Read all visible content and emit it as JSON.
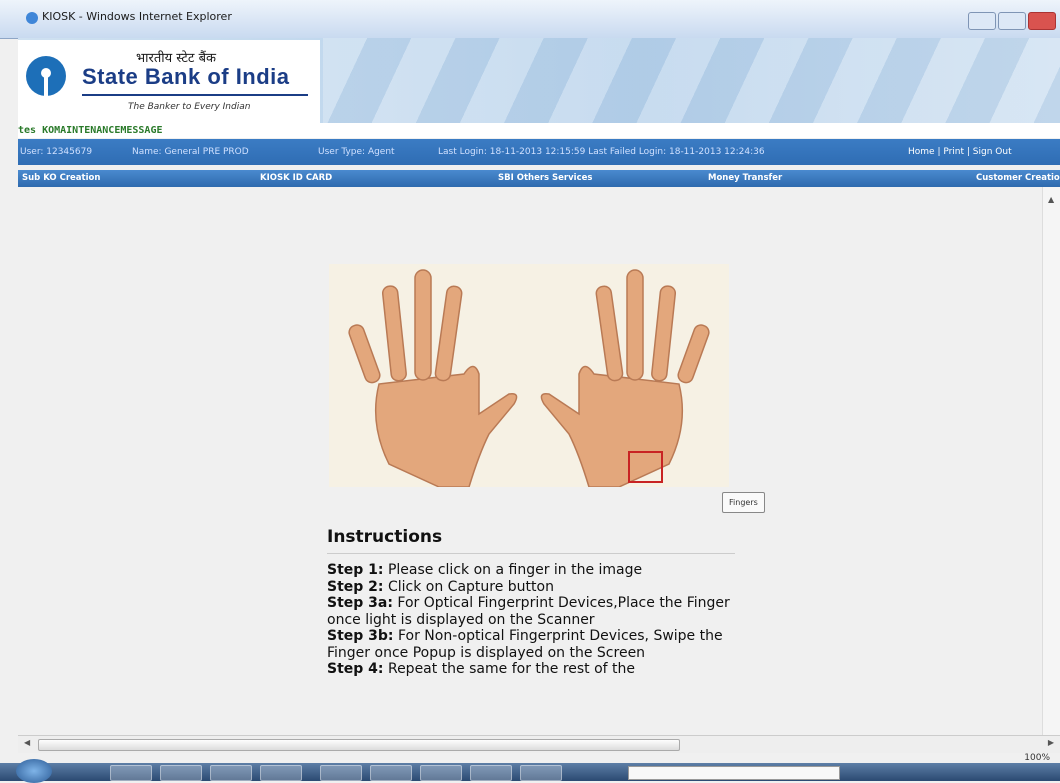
{
  "window": {
    "title": "KIOSK - Windows Internet Explorer"
  },
  "banner": {
    "hindi_name": "भारतीय स्टेट बैंक",
    "bank_name": "State Bank of India",
    "tagline": "The Banker to Every Indian"
  },
  "ticker": {
    "text": "tes  KOMAINTENANCEMESSAGE"
  },
  "infobar": {
    "user": "User: 12345679",
    "name": "Name: General  PRE PROD",
    "user_type": "User Type: Agent",
    "last_login": "Last Login: 18-11-2013 12:15:59  Last Failed Login: 18-11-2013 12:24:36",
    "links": "Home  |  Print  |  Sign Out"
  },
  "menu": {
    "items": [
      "Sub KO Creation",
      "KIOSK ID CARD",
      "SBI Others Services",
      "Money Transfer",
      "Customer Creatio"
    ]
  },
  "fingers_button": "Fingers",
  "instructions": {
    "heading": "Instructions",
    "steps": [
      {
        "label": "Step 1:",
        "text": " Please click on a finger in the image"
      },
      {
        "label": "Step 2:",
        "text": " Click on Capture button"
      },
      {
        "label": "Step 3a:",
        "text": " For Optical Fingerprint Devices,Place the Finger once light is displayed on the Scanner"
      },
      {
        "label": "Step 3b:",
        "text": " For Non-optical Fingerprint Devices, Swipe the Finger once Popup is displayed on the Screen"
      },
      {
        "label": "Step 4:",
        "text": " Repeat the same for the rest of the"
      }
    ]
  },
  "zoom": "100%",
  "colors": {
    "accent": "#2f6db4",
    "ticker": "#2a7a2a",
    "selection": "#c82323"
  }
}
